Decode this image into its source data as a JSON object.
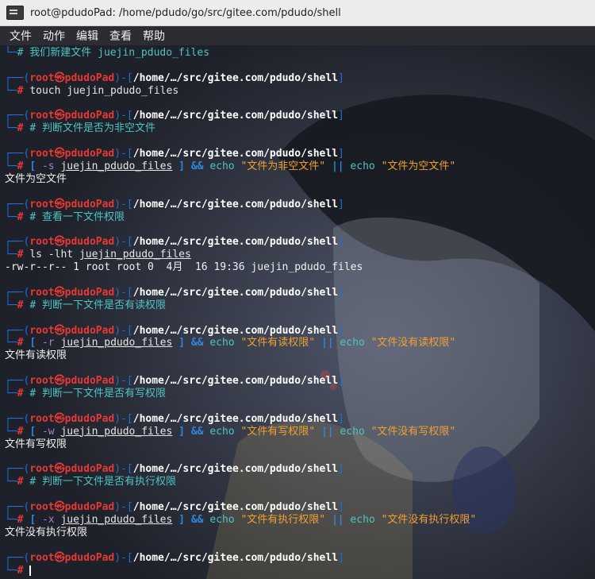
{
  "window": {
    "title": "root@pdudoPad: /home/pdudo/go/src/gitee.com/pdudo/shell"
  },
  "menu": [
    "文件",
    "动作",
    "编辑",
    "查看",
    "帮助"
  ],
  "prompt": {
    "user": "root",
    "symbol": "㉿",
    "host": "pdudoPad",
    "path": "/home/…/src/gitee.com/pdudo/shell",
    "hash": "#"
  },
  "first_comment": "# 我们新建文件 juejin_pdudo_files",
  "blocks": [
    {
      "cmd": "touch juejin_pdudo_files"
    },
    {
      "comment": "# 判断文件是否为非空文件"
    },
    {
      "test": {
        "flag": "-s",
        "file": "juejin_pdudo_files",
        "true_msg": "\"文件为非空文件\"",
        "false_msg": "\"文件为空文件\""
      },
      "output": "文件为空文件"
    },
    {
      "comment": "# 查看一下文件权限"
    },
    {
      "cmd_ls": "ls -lht",
      "file": "juejin_pdudo_files",
      "output": "-rw-r--r-- 1 root root 0  4月  16 19:36 juejin_pdudo_files"
    },
    {
      "comment": "# 判断一下文件是否有读权限"
    },
    {
      "test": {
        "flag": "-r",
        "file": "juejin_pdudo_files",
        "true_msg": "\"文件有读权限\"",
        "false_msg": "\"文件没有读权限\""
      },
      "output": "文件有读权限"
    },
    {
      "comment": "# 判断一下文件是否有写权限"
    },
    {
      "test": {
        "flag": "-w",
        "file": "juejin_pdudo_files",
        "true_msg": "\"文件有写权限\"",
        "false_msg": "\"文件没有写权限\""
      },
      "output": "文件有写权限"
    },
    {
      "comment": "# 判断一下文件是否有执行权限"
    },
    {
      "test": {
        "flag": "-x",
        "file": "juejin_pdudo_files",
        "true_msg": "\"文件有执行权限\"",
        "false_msg": "\"文件没有执行权限\""
      },
      "output": "文件没有执行权限"
    },
    {
      "empty": true
    }
  ],
  "tokens": {
    "bracket_open": "[",
    "bracket_close": "]",
    "and": "&&",
    "or": "||",
    "echo": "echo"
  }
}
